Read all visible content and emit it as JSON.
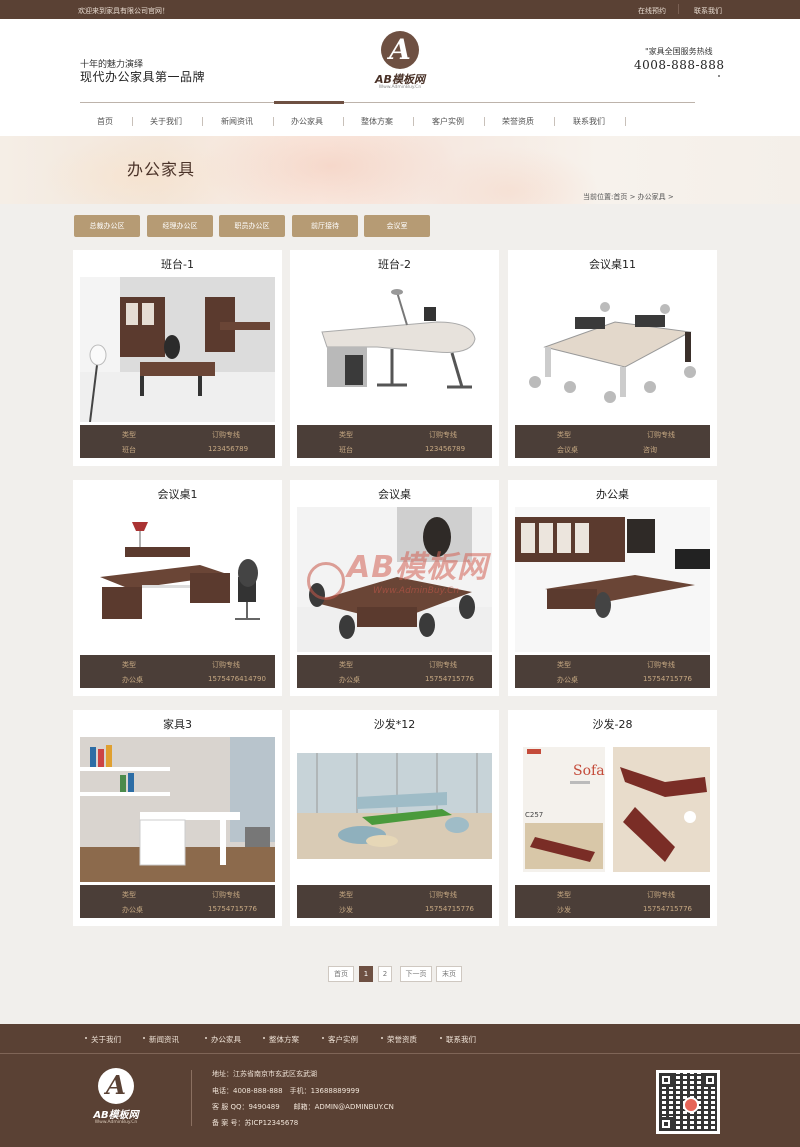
{
  "topbar": {
    "welcome": "欢迎来到家具有限公司官网！",
    "links": [
      "在线预约",
      "联系我们"
    ]
  },
  "header": {
    "slogan_small": "十年的魅力演绎",
    "slogan_large": "现代办公家具第一品牌",
    "logo_brand": "AB模板网",
    "logo_url": "Www.AdminBuy.Cn",
    "hotline_label": "家具全国服务热线",
    "hotline_phone": "4008-888-888"
  },
  "nav": [
    "首页",
    "关于我们",
    "新闻资讯",
    "办公家具",
    "整体方案",
    "客户实例",
    "荣誉资质",
    "联系我们"
  ],
  "nav_active": "办公家具",
  "banner": {
    "title": "办公家具",
    "breadcrumb": "当前位置:首页 > 办公家具 >"
  },
  "filters": [
    "总裁办公区",
    "经理办公区",
    "职员办公区",
    "前厅接待",
    "会议室"
  ],
  "products": [
    {
      "title": "班台-1",
      "k1": "类型",
      "v1": "订购专线",
      "k2": "班台",
      "v2": "123456789"
    },
    {
      "title": "班台-2",
      "k1": "类型",
      "v1": "订购专线",
      "k2": "班台",
      "v2": "123456789"
    },
    {
      "title": "会议桌11",
      "k1": "类型",
      "v1": "订购专线",
      "k2": "会议桌",
      "v2": "咨询"
    },
    {
      "title": "会议桌1",
      "k1": "类型",
      "v1": "订购专线",
      "k2": "办公桌",
      "v2": "15754764147​90"
    },
    {
      "title": "会议桌",
      "k1": "类型",
      "v1": "订购专线",
      "k2": "办公桌",
      "v2": "15754715776"
    },
    {
      "title": "办公桌",
      "k1": "类型",
      "v1": "订购专线",
      "k2": "办公桌",
      "v2": "15754715776"
    },
    {
      "title": "家具3",
      "k1": "类型",
      "v1": "订购专线",
      "k2": "办公桌",
      "v2": "15754715776"
    },
    {
      "title": "沙发*12",
      "k1": "类型",
      "v1": "订购专线",
      "k2": "沙发",
      "v2": "15754715776"
    },
    {
      "title": "沙发-28",
      "k1": "类型",
      "v1": "订购专线",
      "k2": "沙发",
      "v2": "15754715776"
    }
  ],
  "watermark": {
    "brand": "AB模板网",
    "url": "Www.AdminBuy.Cn"
  },
  "pagination": [
    "首页",
    "1",
    "2",
    "下一页",
    "末页"
  ],
  "pagination_current": "1",
  "footer_nav": [
    "关于我们",
    "新闻资讯",
    "办公家具",
    "整体方案",
    "客户实例",
    "荣誉资质",
    "联系我们"
  ],
  "footer": {
    "logo_brand": "AB模板网",
    "logo_url": "Www.AdminBuy.Cn",
    "address": "地址：江苏省南京市玄武区玄武湖",
    "phone": "电话：4008-888-888　手机：13688889999",
    "qq_email": "客 服 QQ：9490489　　邮箱：ADMIN@ADMINBUY.CN",
    "icp": "备 案 号：苏ICP12345678"
  },
  "colors": {
    "brand_brown": "#5a4134",
    "accent_gold": "#b69b74",
    "info_bar": "#4b3e38"
  }
}
